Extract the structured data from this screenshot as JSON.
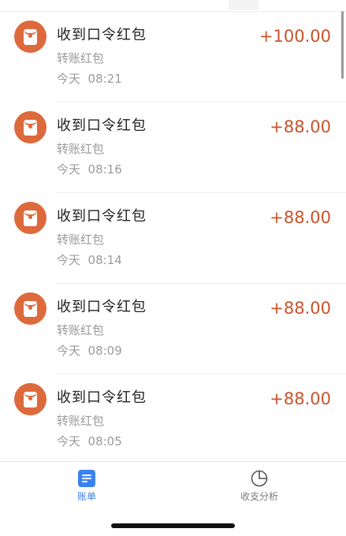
{
  "transactions": [
    {
      "title": "收到口令红包",
      "subtitle": "转账红包",
      "time": "今天  08:21",
      "amount": "+100.00",
      "icon": "red-envelope-icon"
    },
    {
      "title": "收到口令红包",
      "subtitle": "转账红包",
      "time": "今天  08:16",
      "amount": "+88.00",
      "icon": "red-envelope-icon"
    },
    {
      "title": "收到口令红包",
      "subtitle": "转账红包",
      "time": "今天  08:14",
      "amount": "+88.00",
      "icon": "red-envelope-icon"
    },
    {
      "title": "收到口令红包",
      "subtitle": "转账红包",
      "time": "今天  08:09",
      "amount": "+88.00",
      "icon": "red-envelope-icon"
    },
    {
      "title": "收到口令红包",
      "subtitle": "转账红包",
      "time": "今天  08:05",
      "amount": "+88.00",
      "icon": "red-envelope-icon"
    }
  ],
  "bottom_nav": {
    "bills": {
      "label": "账单",
      "icon": "document-icon",
      "active": true
    },
    "analysis": {
      "label": "收支分析",
      "icon": "pie-chart-icon",
      "active": false
    }
  },
  "colors": {
    "amount": "#c9532a",
    "avatar": "#dd6a3c",
    "active_tab": "#3b82f0",
    "inactive_tab": "#7a7a7a"
  }
}
